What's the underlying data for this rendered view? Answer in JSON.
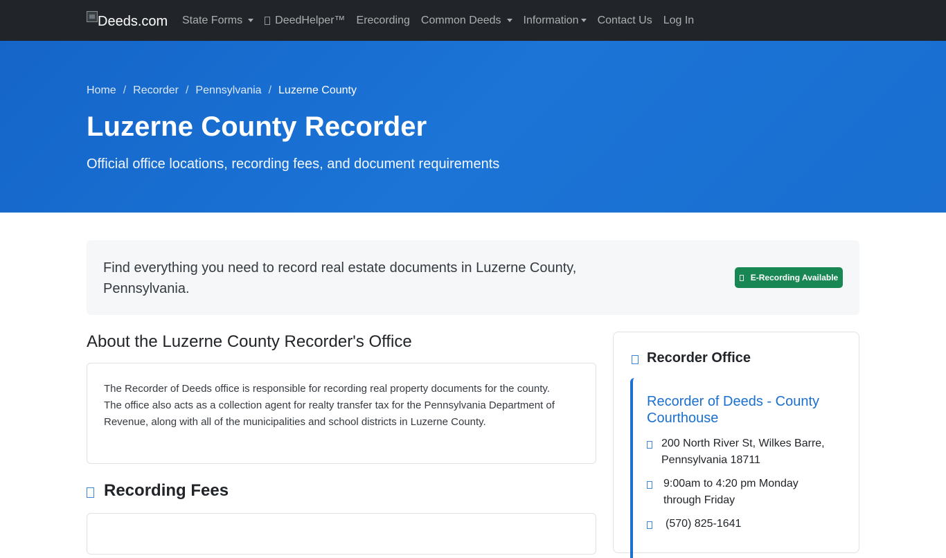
{
  "nav": {
    "brand": "Deeds.com",
    "items": [
      {
        "label": "State Forms",
        "dropdown": true,
        "icon": null
      },
      {
        "label": "DeedHelper™",
        "dropdown": false,
        "icon": "helper-icon"
      },
      {
        "label": "Erecording",
        "dropdown": false,
        "icon": null
      },
      {
        "label": "Common Deeds",
        "dropdown": true,
        "icon": null
      },
      {
        "label": "Information",
        "dropdown": true,
        "icon": null
      },
      {
        "label": "Contact Us",
        "dropdown": false,
        "icon": null
      },
      {
        "label": "Log In",
        "dropdown": false,
        "icon": null
      }
    ]
  },
  "hero": {
    "breadcrumb": [
      "Home",
      "Recorder",
      "Pennsylvania",
      "Luzerne County"
    ],
    "breadcrumb_separator": "/",
    "title": "Luzerne County Recorder",
    "subtitle": "Official office locations, recording fees, and document requirements"
  },
  "intro": {
    "text": "Find everything you need to record real estate documents in Luzerne County, Pennsylvania.",
    "badge": "E-Recording Available"
  },
  "about": {
    "heading": "About the Luzerne County Recorder's Office",
    "body": "The Recorder of Deeds office is responsible for recording real property documents for the county. The office also acts as a collection agent for realty transfer tax for the Pennsylvania Department of Revenue, along with all of the municipalities and school districts in Luzerne County."
  },
  "fees": {
    "heading": "Recording Fees"
  },
  "office": {
    "heading": "Recorder Office",
    "name": "Recorder of Deeds - County Courthouse",
    "address": "200 North River St, Wilkes Barre, Pennsylvania 18711",
    "hours": "9:00am to 4:20 pm Monday through Friday",
    "phone": "(570) 825-1641"
  },
  "colors": {
    "navbar": "#212529",
    "hero": "#1a6fd0",
    "badge": "#198754",
    "accent": "#1a6fd0"
  }
}
